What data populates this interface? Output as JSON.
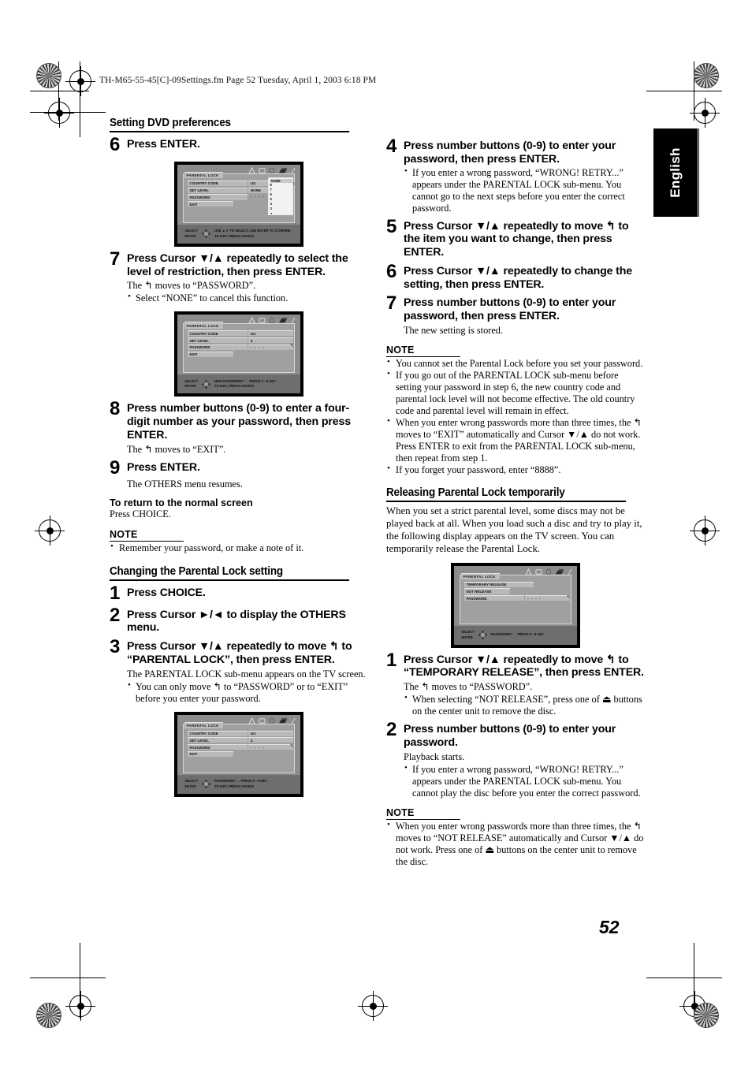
{
  "running_head": "TH-M65-55-45[C]-09Settings.fm  Page 52  Tuesday, April 1, 2003  6:18 PM",
  "language_tab": "English",
  "page_number": "52",
  "left_column": {
    "section_heading": "Setting DVD preferences",
    "step6": {
      "num": "6",
      "text": "Press ENTER."
    },
    "step7": {
      "num": "7",
      "text": "Press Cursor ▼/▲ repeatedly to select the level of restriction, then press ENTER.",
      "sub": "The ↰ moves to “PASSWORD”.",
      "bullets": [
        "Select “NONE” to cancel this function."
      ]
    },
    "step8": {
      "num": "8",
      "text": "Press number buttons (0-9) to enter a four-digit number as your password, then press ENTER.",
      "sub": "The ↰ moves to “EXIT”."
    },
    "step9": {
      "num": "9",
      "text": "Press ENTER.",
      "sub": "The OTHERS menu resumes."
    },
    "return_heading": "To return to the normal screen",
    "return_text": "Press CHOICE.",
    "note_heading": "NOTE",
    "note_bullets": [
      "Remember your password, or make a note of it."
    ],
    "changing_heading": "Changing the Parental Lock setting",
    "step1": {
      "num": "1",
      "text": "Press CHOICE."
    },
    "step2": {
      "num": "2",
      "text": "Press Cursor ►/◄ to display the OTHERS menu."
    },
    "step3": {
      "num": "3",
      "text": "Press Cursor ▼/▲ repeatedly to move ↰ to “PARENTAL LOCK”, then press ENTER.",
      "sub": "The PARENTAL LOCK sub-menu appears on the TV screen.",
      "bullets": [
        "You can only move ↰ to “PASSWORD” or to “EXIT” before you enter your password."
      ]
    }
  },
  "right_column": {
    "step4": {
      "num": "4",
      "text": "Press number buttons (0-9) to enter your password, then press ENTER.",
      "bullets": [
        "If you enter a wrong password, “WRONG! RETRY...” appears under the PARENTAL LOCK sub-menu. You cannot go to the next steps before you enter the correct password."
      ]
    },
    "step5": {
      "num": "5",
      "text": "Press Cursor ▼/▲ repeatedly to move ↰ to the item you want to change, then press ENTER."
    },
    "step6": {
      "num": "6",
      "text": "Press Cursor ▼/▲ repeatedly to change the setting, then press ENTER."
    },
    "step7": {
      "num": "7",
      "text": "Press number buttons (0-9) to enter your password, then press ENTER.",
      "sub": "The new setting is stored."
    },
    "note_heading": "NOTE",
    "note_bullets": [
      "You cannot set the Parental Lock before you set your password.",
      "If you go out of the PARENTAL LOCK sub-menu before setting your password in step 6, the new country code and parental lock level will not become effective. The old country code and parental level will remain in effect.",
      "When you enter wrong passwords more than three times, the ↰ moves to “EXIT” automatically and Cursor ▼/▲ do not work. Press ENTER to exit from the PARENTAL LOCK sub-menu, then repeat from step 1.",
      "If you forget your password, enter “8888”."
    ],
    "releasing_heading": "Releasing Parental Lock temporarily",
    "releasing_intro": "When you set a strict parental level, some discs may not be played back at all. When you load such a disc and try to play it, the following display appears on the TV screen. You can temporarily release the Parental Lock.",
    "rstep1": {
      "num": "1",
      "text": "Press Cursor ▼/▲ repeatedly to move ↰ to “TEMPORARY RELEASE”, then press ENTER.",
      "sub": "The ↰ moves to “PASSWORD”.",
      "bullets": [
        "When selecting “NOT RELEASE”, press one of ⏏ buttons on the center unit to remove the disc."
      ]
    },
    "rstep2": {
      "num": "2",
      "text": "Press number buttons (0-9) to enter your password.",
      "sub": "Playback starts.",
      "bullets": [
        "If you enter a wrong password, “WRONG! RETRY...” appears under the PARENTAL LOCK sub-menu. You cannot play the disc before you enter the correct password."
      ]
    },
    "note2_heading": "NOTE",
    "note2_bullets": [
      "When you enter wrong passwords more than three times, the ↰ moves to “NOT RELEASE” automatically and Cursor ▼/▲ do not work. Press one of ⏏ buttons on the center unit to remove the disc."
    ]
  },
  "tv_screens": {
    "screen1": {
      "title": "PARENTAL LOCK",
      "rows": [
        {
          "label": "COUNTRY CODE",
          "value": "US"
        },
        {
          "label": "SET LEVEL",
          "value": "NONE"
        },
        {
          "label": "PASSWORD",
          "value": "- - - -"
        },
        {
          "label": "EXIT",
          "value": ""
        }
      ],
      "dropdown": {
        "selected": "NONE",
        "items": [
          "8",
          "7",
          "6",
          "5",
          "4",
          "3"
        ]
      },
      "status_left": [
        "SELECT",
        "ENTER"
      ],
      "status_msg": [
        "USE ▲▼ TO SELECT, USE ENTER TO CONFIRM.",
        "TO EXIT, PRESS CHOICE."
      ]
    },
    "screen2": {
      "title": "PARENTAL LOCK",
      "rows": [
        {
          "label": "COUNTRY CODE",
          "value": "US"
        },
        {
          "label": "SET LEVEL",
          "value": "4"
        },
        {
          "label": "PASSWORD",
          "value": "- - - -"
        },
        {
          "label": "EXIT",
          "value": ""
        }
      ],
      "status_left": [
        "SELECT",
        "ENTER"
      ],
      "status_msg": [
        "NEW PASSWORD? → PRESS 0 - 9 KEY",
        "TO EXIT, PRESS CHOICE."
      ]
    },
    "screen3": {
      "title": "PARENTAL LOCK",
      "rows": [
        {
          "label": "COUNTRY CODE",
          "value": "US"
        },
        {
          "label": "SET LEVEL",
          "value": "4"
        },
        {
          "label": "PASSWORD",
          "value": "- - - -"
        },
        {
          "label": "EXIT",
          "value": ""
        }
      ],
      "status_left": [
        "SELECT",
        "ENTER"
      ],
      "status_msg": [
        "PASSWORD? → PRESS 0 - 9 KEY",
        "TO EXIT, PRESS CHOICE."
      ]
    },
    "screen4": {
      "title": "PARENTAL LOCK",
      "rows": [
        {
          "label": "TEMPORARY RELEASE",
          "value": ""
        },
        {
          "label": "NOT RELEASE",
          "value": ""
        },
        {
          "label": "PASSWORD",
          "value": "- - - -"
        }
      ],
      "status_left": [
        "SELECT",
        "ENTER"
      ],
      "status_msg": [
        "PASSWORD? → PRESS 0 - 9 KEY",
        ""
      ]
    }
  }
}
